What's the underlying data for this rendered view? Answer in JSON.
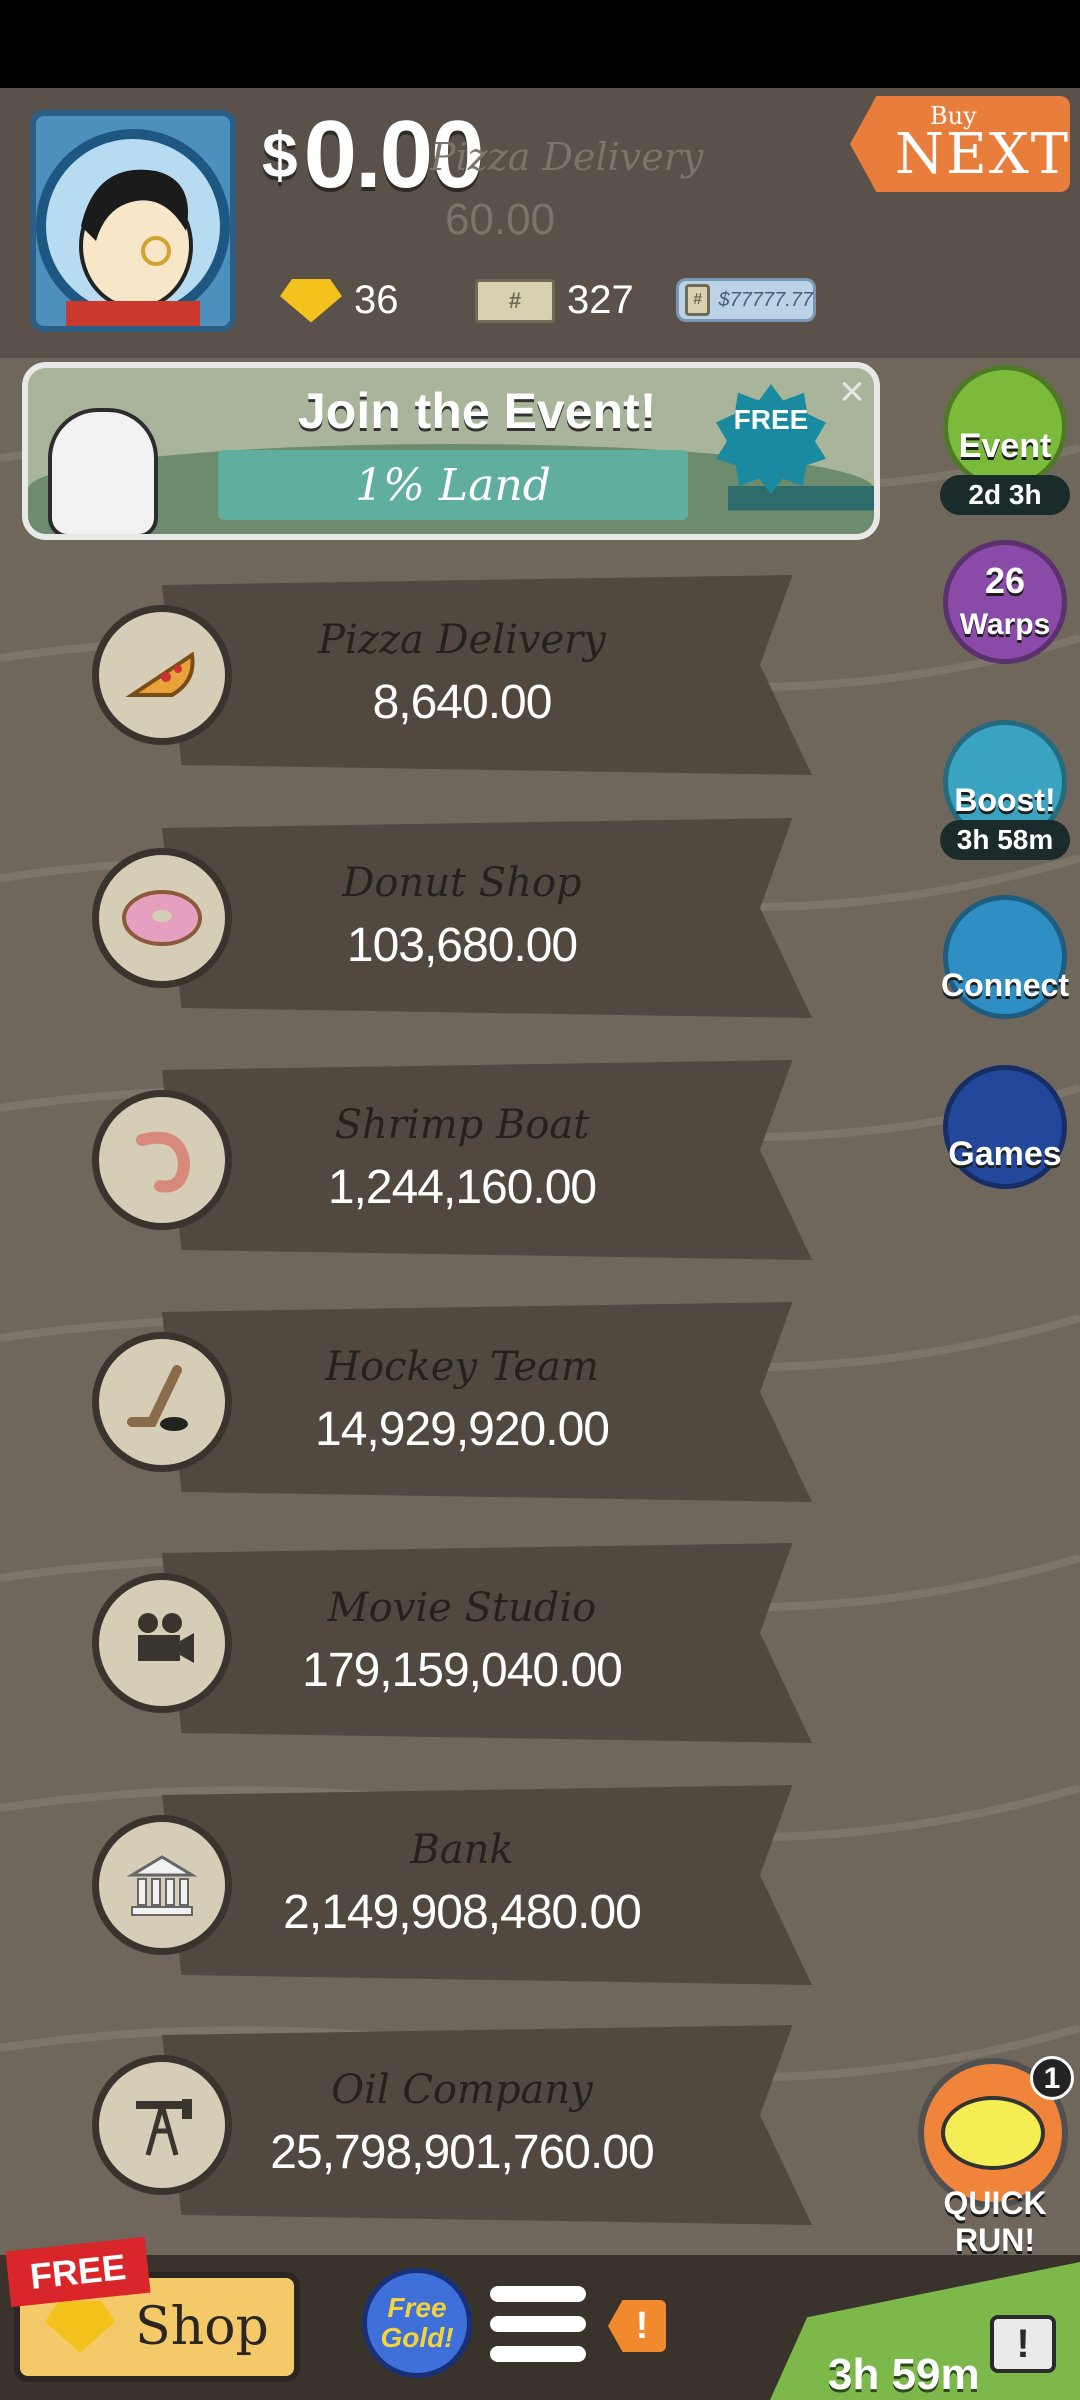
{
  "header": {
    "currency_symbol": "$",
    "cash": "0.00",
    "ghost_title": "Pizza Delivery",
    "ghost_value": "60.00",
    "gold": "36",
    "megabucks": "327",
    "ticket_value": "$77777.77",
    "bill_symbol": "#",
    "buy_label": "Buy",
    "next_label": "NEXT"
  },
  "event_banner": {
    "title": "Join the Event!",
    "subtitle": "1% Land",
    "free_label": "FREE",
    "close_symbol": "×"
  },
  "side_buttons": [
    {
      "label": "Event",
      "timer": "2d 3h",
      "color": "#7cba3b"
    },
    {
      "label": "Warps",
      "count": "26",
      "color": "#8a4aa8"
    },
    {
      "label": "Boost!",
      "timer": "3h 58m",
      "color": "#3aa3c1"
    },
    {
      "label": "Connect",
      "color": "#2f8fc5"
    },
    {
      "label": "Games",
      "color": "#23489b"
    }
  ],
  "businesses": [
    {
      "name": "Pizza Delivery",
      "value": "8,640.00",
      "icon": "pizza-icon"
    },
    {
      "name": "Donut Shop",
      "value": "103,680.00",
      "icon": "donut-icon"
    },
    {
      "name": "Shrimp Boat",
      "value": "1,244,160.00",
      "icon": "shrimp-icon"
    },
    {
      "name": "Hockey Team",
      "value": "14,929,920.00",
      "icon": "hockey-icon"
    },
    {
      "name": "Movie Studio",
      "value": "179,159,040.00",
      "icon": "film-camera-icon"
    },
    {
      "name": "Bank",
      "value": "2,149,908,480.00",
      "icon": "bank-icon"
    },
    {
      "name": "Oil Company",
      "value": "25,798,901,760.00",
      "icon": "oil-rig-icon"
    }
  ],
  "bottom": {
    "free_tag": "FREE",
    "shop_label": "Shop",
    "free_gold_line1": "Free",
    "free_gold_line2": "Gold!",
    "alert_symbol": "!",
    "quick_run_label": "QUICK RUN!",
    "quick_run_badge": "1",
    "timer": "3h 59m",
    "tv_symbol": "!"
  }
}
